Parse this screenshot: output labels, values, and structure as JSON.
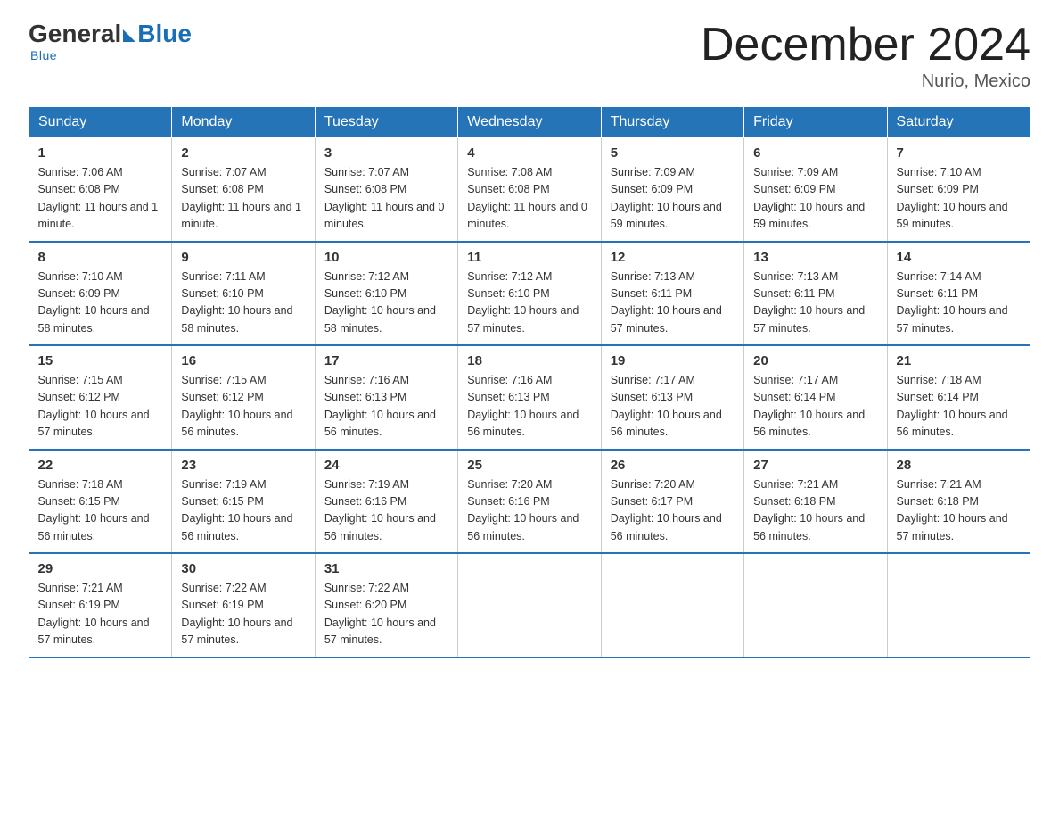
{
  "logo": {
    "general": "General",
    "blue": "Blue",
    "tagline": "Blue"
  },
  "header": {
    "month_title": "December 2024",
    "location": "Nurio, Mexico"
  },
  "days_of_week": [
    "Sunday",
    "Monday",
    "Tuesday",
    "Wednesday",
    "Thursday",
    "Friday",
    "Saturday"
  ],
  "weeks": [
    [
      {
        "day": "1",
        "sunrise": "7:06 AM",
        "sunset": "6:08 PM",
        "daylight": "11 hours and 1 minute."
      },
      {
        "day": "2",
        "sunrise": "7:07 AM",
        "sunset": "6:08 PM",
        "daylight": "11 hours and 1 minute."
      },
      {
        "day": "3",
        "sunrise": "7:07 AM",
        "sunset": "6:08 PM",
        "daylight": "11 hours and 0 minutes."
      },
      {
        "day": "4",
        "sunrise": "7:08 AM",
        "sunset": "6:08 PM",
        "daylight": "11 hours and 0 minutes."
      },
      {
        "day": "5",
        "sunrise": "7:09 AM",
        "sunset": "6:09 PM",
        "daylight": "10 hours and 59 minutes."
      },
      {
        "day": "6",
        "sunrise": "7:09 AM",
        "sunset": "6:09 PM",
        "daylight": "10 hours and 59 minutes."
      },
      {
        "day": "7",
        "sunrise": "7:10 AM",
        "sunset": "6:09 PM",
        "daylight": "10 hours and 59 minutes."
      }
    ],
    [
      {
        "day": "8",
        "sunrise": "7:10 AM",
        "sunset": "6:09 PM",
        "daylight": "10 hours and 58 minutes."
      },
      {
        "day": "9",
        "sunrise": "7:11 AM",
        "sunset": "6:10 PM",
        "daylight": "10 hours and 58 minutes."
      },
      {
        "day": "10",
        "sunrise": "7:12 AM",
        "sunset": "6:10 PM",
        "daylight": "10 hours and 58 minutes."
      },
      {
        "day": "11",
        "sunrise": "7:12 AM",
        "sunset": "6:10 PM",
        "daylight": "10 hours and 57 minutes."
      },
      {
        "day": "12",
        "sunrise": "7:13 AM",
        "sunset": "6:11 PM",
        "daylight": "10 hours and 57 minutes."
      },
      {
        "day": "13",
        "sunrise": "7:13 AM",
        "sunset": "6:11 PM",
        "daylight": "10 hours and 57 minutes."
      },
      {
        "day": "14",
        "sunrise": "7:14 AM",
        "sunset": "6:11 PM",
        "daylight": "10 hours and 57 minutes."
      }
    ],
    [
      {
        "day": "15",
        "sunrise": "7:15 AM",
        "sunset": "6:12 PM",
        "daylight": "10 hours and 57 minutes."
      },
      {
        "day": "16",
        "sunrise": "7:15 AM",
        "sunset": "6:12 PM",
        "daylight": "10 hours and 56 minutes."
      },
      {
        "day": "17",
        "sunrise": "7:16 AM",
        "sunset": "6:13 PM",
        "daylight": "10 hours and 56 minutes."
      },
      {
        "day": "18",
        "sunrise": "7:16 AM",
        "sunset": "6:13 PM",
        "daylight": "10 hours and 56 minutes."
      },
      {
        "day": "19",
        "sunrise": "7:17 AM",
        "sunset": "6:13 PM",
        "daylight": "10 hours and 56 minutes."
      },
      {
        "day": "20",
        "sunrise": "7:17 AM",
        "sunset": "6:14 PM",
        "daylight": "10 hours and 56 minutes."
      },
      {
        "day": "21",
        "sunrise": "7:18 AM",
        "sunset": "6:14 PM",
        "daylight": "10 hours and 56 minutes."
      }
    ],
    [
      {
        "day": "22",
        "sunrise": "7:18 AM",
        "sunset": "6:15 PM",
        "daylight": "10 hours and 56 minutes."
      },
      {
        "day": "23",
        "sunrise": "7:19 AM",
        "sunset": "6:15 PM",
        "daylight": "10 hours and 56 minutes."
      },
      {
        "day": "24",
        "sunrise": "7:19 AM",
        "sunset": "6:16 PM",
        "daylight": "10 hours and 56 minutes."
      },
      {
        "day": "25",
        "sunrise": "7:20 AM",
        "sunset": "6:16 PM",
        "daylight": "10 hours and 56 minutes."
      },
      {
        "day": "26",
        "sunrise": "7:20 AM",
        "sunset": "6:17 PM",
        "daylight": "10 hours and 56 minutes."
      },
      {
        "day": "27",
        "sunrise": "7:21 AM",
        "sunset": "6:18 PM",
        "daylight": "10 hours and 56 minutes."
      },
      {
        "day": "28",
        "sunrise": "7:21 AM",
        "sunset": "6:18 PM",
        "daylight": "10 hours and 57 minutes."
      }
    ],
    [
      {
        "day": "29",
        "sunrise": "7:21 AM",
        "sunset": "6:19 PM",
        "daylight": "10 hours and 57 minutes."
      },
      {
        "day": "30",
        "sunrise": "7:22 AM",
        "sunset": "6:19 PM",
        "daylight": "10 hours and 57 minutes."
      },
      {
        "day": "31",
        "sunrise": "7:22 AM",
        "sunset": "6:20 PM",
        "daylight": "10 hours and 57 minutes."
      },
      null,
      null,
      null,
      null
    ]
  ]
}
